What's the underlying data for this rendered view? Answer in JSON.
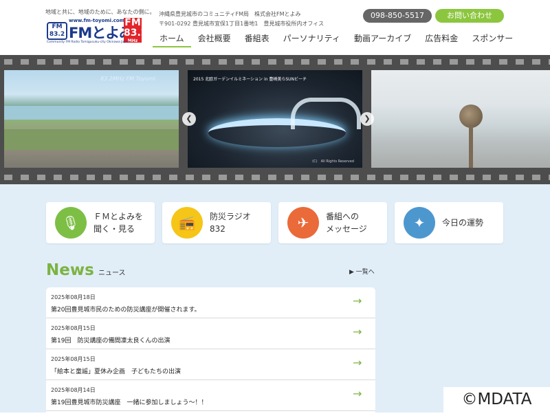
{
  "header": {
    "tagline": "地域と共に、地域のために、あなたの側に。",
    "logo": {
      "url": "www.fm-toyomi.com",
      "fm_badge": "FM",
      "name": "FMとよみ",
      "freq_top": "FM",
      "freq": "83.2",
      "freq_unit": "MHz",
      "subline": "Community FM Radio Tomigusuku-city Okinawa Japan"
    },
    "company_line1": "沖縄県豊見城市のコミュニティFM局　株式会社FMとよみ",
    "company_line2": "〒901-0292 豊見城市宜保1丁目1番地1　豊見城市役所内オフィス",
    "phone": "098-850-5517",
    "contact_label": "お問い合わせ"
  },
  "nav": [
    {
      "label": "ホーム",
      "active": true
    },
    {
      "label": "会社概要"
    },
    {
      "label": "番組表"
    },
    {
      "label": "パーソナリティ"
    },
    {
      "label": "動画アーカイブ"
    },
    {
      "label": "広告料金"
    },
    {
      "label": "スポンサー"
    }
  ],
  "slider": {
    "slide1_caption": "83.2MHz FM Toyomi",
    "slide2_caption": "2015 北欧ガーデンイルミネーション in 豊崎美らSUNビーチ",
    "slide2_copyright": "(C)　All Rights Reserved",
    "prev_arrow": "❮",
    "next_arrow": "❯"
  },
  "cards": [
    {
      "icon": "microphone-icon",
      "glyph": "🎙",
      "line1": "ＦＭとよみを",
      "line2": "聞く・見る",
      "color": "#7dbf45"
    },
    {
      "icon": "radio-icon",
      "glyph": "📻",
      "line1": "防災ラジオ",
      "line2": "832",
      "color": "#f5c518"
    },
    {
      "icon": "paper-plane-icon",
      "glyph": "✈",
      "line1": "番組への",
      "line2": "メッセージ",
      "color": "#ea6a3a"
    },
    {
      "icon": "fortune-icon",
      "glyph": "✦",
      "line1": "今日の運勢",
      "line2": "",
      "color": "#4d97cf"
    }
  ],
  "news": {
    "title": "News",
    "subtitle": "ニュース",
    "more": "▶ 一覧へ",
    "items": [
      {
        "date": "2025年08月18日",
        "text": "第20回豊見城市民のための防災講座が開催されます。"
      },
      {
        "date": "2025年08月15日",
        "text": "第19回　防災講座の備間凜太良くんの出演"
      },
      {
        "date": "2025年08月15日",
        "text": "「絵本と童謡」夏休み企画　子どもたちの出演"
      },
      {
        "date": "2025年08月14日",
        "text": "第19回豊見城市防災講座　一緒に参加しましょう〜！！"
      }
    ],
    "arrow": "→"
  },
  "watermark": "©MDATA"
}
